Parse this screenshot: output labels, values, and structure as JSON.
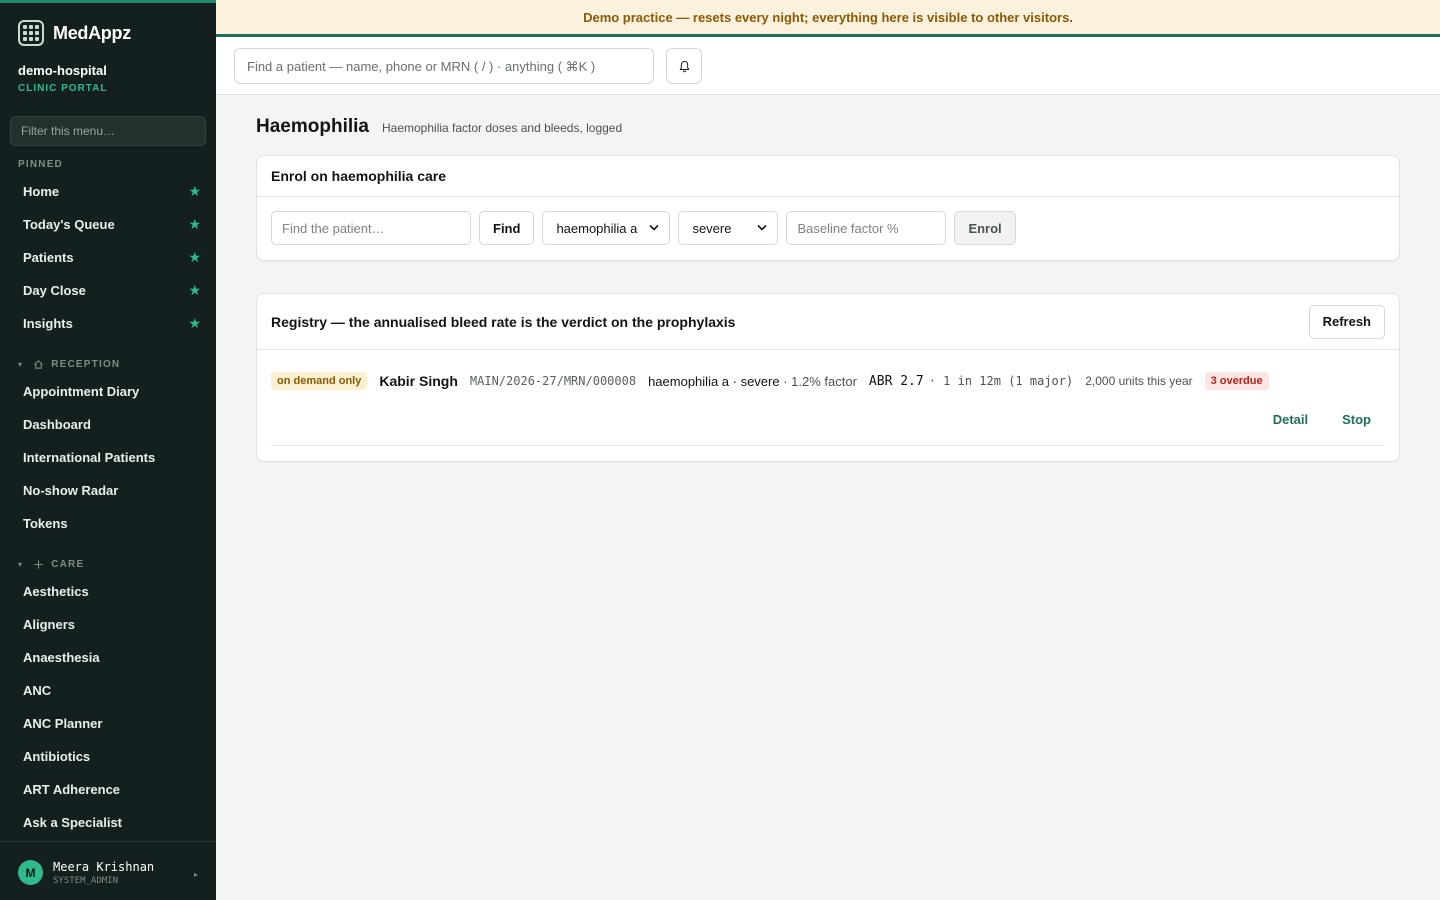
{
  "app": {
    "name": "MedAppz",
    "org": "demo-hospital",
    "portal": "CLINIC PORTAL"
  },
  "banner": {
    "text": "Demo practice — resets every night; everything here is visible to other visitors."
  },
  "header": {
    "search_placeholder": "Find a patient — name, phone or MRN ( / ) · anything ( ⌘K )"
  },
  "sidebar": {
    "filter_placeholder": "Filter this menu…",
    "pinned_label": "PINNED",
    "pinned": [
      {
        "label": "Home"
      },
      {
        "label": "Today's Queue"
      },
      {
        "label": "Patients"
      },
      {
        "label": "Day Close"
      },
      {
        "label": "Insights"
      }
    ],
    "reception_label": "RECEPTION",
    "reception": [
      {
        "label": "Appointment Diary"
      },
      {
        "label": "Dashboard"
      },
      {
        "label": "International Patients"
      },
      {
        "label": "No-show Radar"
      },
      {
        "label": "Tokens"
      }
    ],
    "care_label": "CARE",
    "care": [
      {
        "label": "Aesthetics"
      },
      {
        "label": "Aligners"
      },
      {
        "label": "Anaesthesia"
      },
      {
        "label": "ANC"
      },
      {
        "label": "ANC Planner"
      },
      {
        "label": "Antibiotics"
      },
      {
        "label": "ART Adherence"
      },
      {
        "label": "Ask a Specialist"
      }
    ],
    "star": "★"
  },
  "user": {
    "initial": "M",
    "name": "Meera Krishnan",
    "role": "SYSTEM_ADMIN"
  },
  "page": {
    "title": "Haemophilia",
    "subtitle": "Haemophilia factor doses and bleeds, logged"
  },
  "enrol": {
    "title": "Enrol on haemophilia care",
    "patient_placeholder": "Find the patient…",
    "find_label": "Find",
    "type_value": "haemophilia a",
    "severity_value": "severe",
    "baseline_placeholder": "Baseline factor %",
    "enrol_label": "Enrol"
  },
  "registry": {
    "title": "Registry — the annualised bleed rate is the verdict on the prophylaxis",
    "refresh_label": "Refresh",
    "rows": [
      {
        "regimen": "on demand only",
        "name": "Kabir Singh",
        "mrn": "MAIN/2026-27/MRN/000008",
        "diagnosis": "haemophilia a · severe",
        "factor": " · 1.2% factor",
        "abr": "ABR 2.7",
        "bleeds": "· 1 in 12m (1 major)",
        "units": "2,000 units this year",
        "overdue": "3 overdue",
        "detail_label": "Detail",
        "stop_label": "Stop"
      }
    ]
  },
  "colors": {
    "accent": "#1f6e57",
    "sidebar_bg": "#14201f",
    "banner_bg": "#fbf1dd",
    "star": "#2fb98c"
  }
}
